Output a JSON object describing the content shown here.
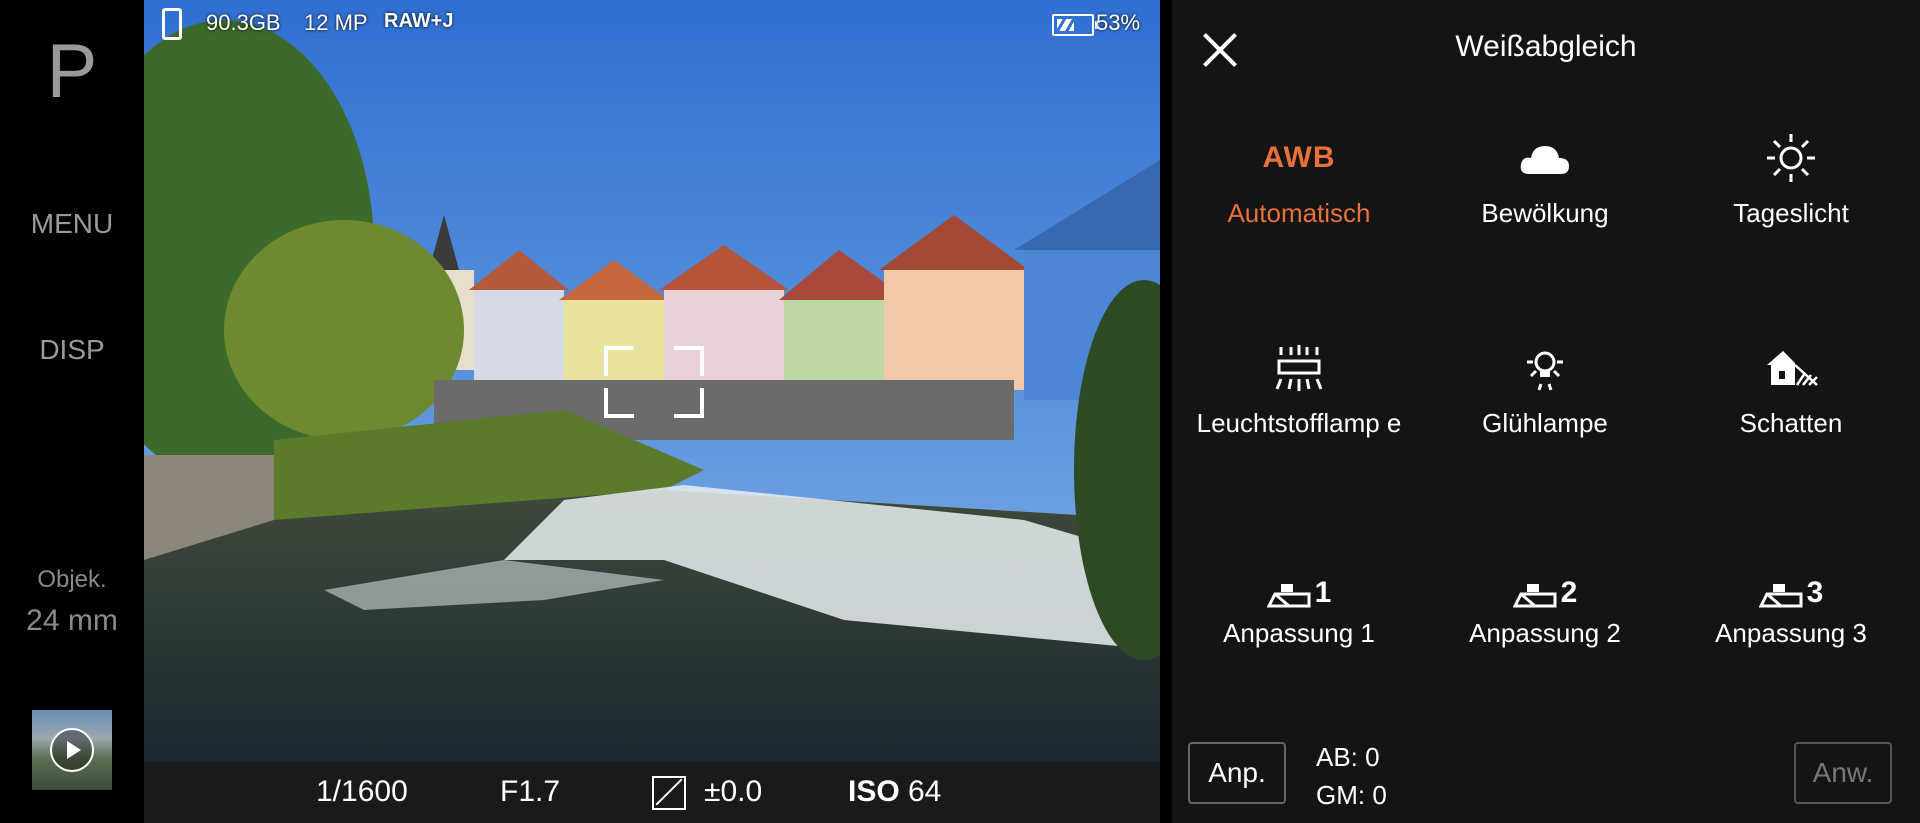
{
  "left_rail": {
    "mode": "P",
    "menu_label": "MENU",
    "disp_label": "DISP",
    "lens_label": "Objek.",
    "lens_value": "24 mm",
    "thumbnail_icon": "play-icon"
  },
  "status_bar": {
    "storage": "90.3GB",
    "megapixels": "12 MP",
    "format": "RAW+J",
    "battery_percent": "53%",
    "battery_level": 0.53
  },
  "exposure": {
    "shutter": "1/1600",
    "aperture": "F1.7",
    "ev": "±0.0",
    "iso_label": "ISO",
    "iso_value": "64"
  },
  "wb_panel": {
    "title": "Weißabgleich",
    "options": [
      {
        "id": "awb",
        "icon_text": "AWB",
        "label": "Automatisch",
        "selected": true
      },
      {
        "id": "cloudy",
        "icon": "cloud-icon",
        "label": "Bewölkung"
      },
      {
        "id": "daylight",
        "icon": "sun-icon",
        "label": "Tageslicht"
      },
      {
        "id": "fluorescent",
        "icon": "fluorescent-icon",
        "label": "Leuchtstofflamp e"
      },
      {
        "id": "incandescent",
        "icon": "bulb-icon",
        "label": "Glühlampe"
      },
      {
        "id": "shade",
        "icon": "shade-icon",
        "label": "Schatten"
      },
      {
        "id": "custom1",
        "icon_num": "1",
        "label": "Anpassung 1"
      },
      {
        "id": "custom2",
        "icon_num": "2",
        "label": "Anpassung 2"
      },
      {
        "id": "custom3",
        "icon_num": "3",
        "label": "Anpassung 3"
      }
    ],
    "adjust_label": "Anp.",
    "ab_value": "AB: 0",
    "gm_value": "GM: 0",
    "apply_label": "Anw."
  },
  "colors": {
    "accent": "#e8703a",
    "panel_bg": "#141414",
    "rail_text": "#9a9a9a"
  }
}
